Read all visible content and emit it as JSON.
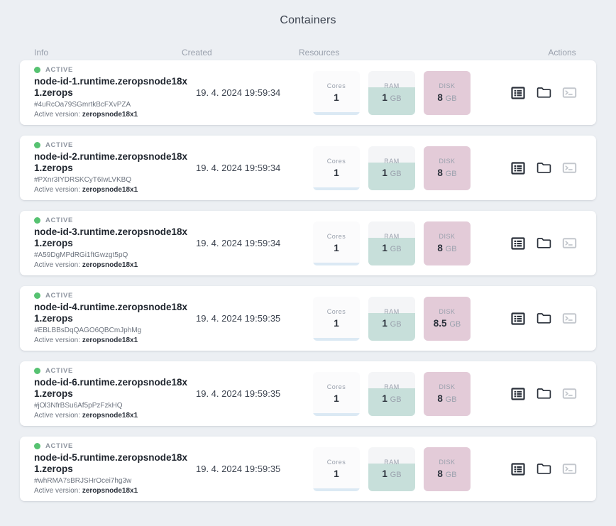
{
  "header": {
    "title": "Containers"
  },
  "columns": {
    "info": "Info",
    "created": "Created",
    "resources": "Resources",
    "actions": "Actions"
  },
  "labels": {
    "status": "ACTIVE",
    "cores": "Cores",
    "ram": "RAM",
    "disk": "DISK",
    "unit_gb": "GB",
    "active_version_prefix": "Active version:"
  },
  "colors": {
    "page_background": "#eceff3",
    "card_background": "#ffffff",
    "status_dot": "#56c271",
    "cores_fill": "#dbe9f4",
    "ram_fill": "#c7dfda",
    "disk_fill": "#e3cbd8",
    "res_card_base": "#fbfbfc",
    "icon_dark": "#2b313b",
    "icon_disabled": "#c3c7cd",
    "text_primary": "#2b313b",
    "text_muted": "#9aa1ad"
  },
  "actions": [
    {
      "name": "log-icon",
      "label": "Logs",
      "enabled": true
    },
    {
      "name": "folder-icon",
      "label": "Files",
      "enabled": true
    },
    {
      "name": "terminal-icon",
      "label": "Terminal",
      "enabled": false
    }
  ],
  "rows": [
    {
      "status": "ACTIVE",
      "name": "node-id-1.runtime.zeropsnode18x1.zerops",
      "hash": "#4uRcOa79SGmrtkBcFXvPZA",
      "version": "zeropsnode18x1",
      "created": "19. 4. 2024 19:59:34",
      "cores": {
        "label": "Cores",
        "value": "1",
        "unit": "",
        "fill_pct": 6
      },
      "ram": {
        "label": "RAM",
        "value": "1",
        "unit": "GB",
        "fill_pct": 62
      },
      "disk": {
        "label": "DISK",
        "value": "8",
        "unit": "GB",
        "fill_pct": 100
      }
    },
    {
      "status": "ACTIVE",
      "name": "node-id-2.runtime.zeropsnode18x1.zerops",
      "hash": "#PXnr3IYDRSKCyT6IwLVKBQ",
      "version": "zeropsnode18x1",
      "created": "19. 4. 2024 19:59:34",
      "cores": {
        "label": "Cores",
        "value": "1",
        "unit": "",
        "fill_pct": 6
      },
      "ram": {
        "label": "RAM",
        "value": "1",
        "unit": "GB",
        "fill_pct": 62
      },
      "disk": {
        "label": "DISK",
        "value": "8",
        "unit": "GB",
        "fill_pct": 100
      }
    },
    {
      "status": "ACTIVE",
      "name": "node-id-3.runtime.zeropsnode18x1.zerops",
      "hash": "#A59DgMPdRGi1ftGwzgt5pQ",
      "version": "zeropsnode18x1",
      "created": "19. 4. 2024 19:59:34",
      "cores": {
        "label": "Cores",
        "value": "1",
        "unit": "",
        "fill_pct": 6
      },
      "ram": {
        "label": "RAM",
        "value": "1",
        "unit": "GB",
        "fill_pct": 62
      },
      "disk": {
        "label": "DISK",
        "value": "8",
        "unit": "GB",
        "fill_pct": 100
      }
    },
    {
      "status": "ACTIVE",
      "name": "node-id-4.runtime.zeropsnode18x1.zerops",
      "hash": "#EBLBBsDqQAGO6QBCmJphMg",
      "version": "zeropsnode18x1",
      "created": "19. 4. 2024 19:59:35",
      "cores": {
        "label": "Cores",
        "value": "1",
        "unit": "",
        "fill_pct": 6
      },
      "ram": {
        "label": "RAM",
        "value": "1",
        "unit": "GB",
        "fill_pct": 62
      },
      "disk": {
        "label": "DISK",
        "value": "8.5",
        "unit": "GB",
        "fill_pct": 100
      }
    },
    {
      "status": "ACTIVE",
      "name": "node-id-6.runtime.zeropsnode18x1.zerops",
      "hash": "#jOl3NfrBSu6Af5pPzFzkHQ",
      "version": "zeropsnode18x1",
      "created": "19. 4. 2024 19:59:35",
      "cores": {
        "label": "Cores",
        "value": "1",
        "unit": "",
        "fill_pct": 6
      },
      "ram": {
        "label": "RAM",
        "value": "1",
        "unit": "GB",
        "fill_pct": 62
      },
      "disk": {
        "label": "DISK",
        "value": "8",
        "unit": "GB",
        "fill_pct": 100
      }
    },
    {
      "status": "ACTIVE",
      "name": "node-id-5.runtime.zeropsnode18x1.zerops",
      "hash": "#whRMA7sBRJSHrOcei7hg3w",
      "version": "zeropsnode18x1",
      "created": "19. 4. 2024 19:59:35",
      "cores": {
        "label": "Cores",
        "value": "1",
        "unit": "",
        "fill_pct": 6
      },
      "ram": {
        "label": "RAM",
        "value": "1",
        "unit": "GB",
        "fill_pct": 62
      },
      "disk": {
        "label": "DISK",
        "value": "8",
        "unit": "GB",
        "fill_pct": 100
      }
    }
  ]
}
